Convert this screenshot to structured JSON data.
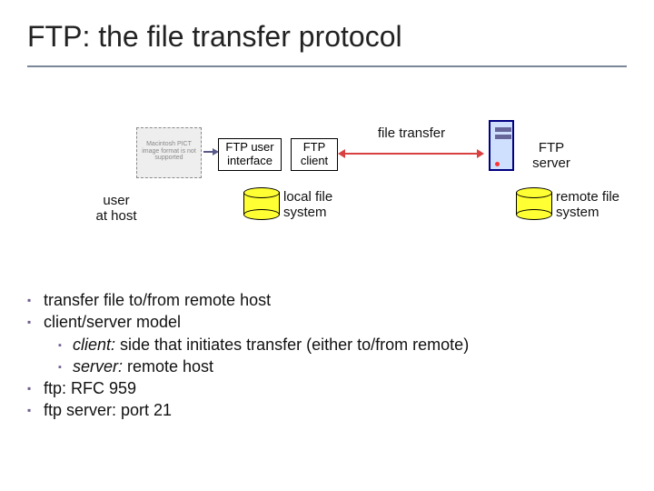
{
  "title": "FTP: the file transfer protocol",
  "diagram": {
    "user_at_host": "user\nat host",
    "ftp_user_interface": "FTP user\ninterface",
    "ftp_client": "FTP\nclient",
    "ftp_server": "FTP\nserver",
    "file_transfer": "file transfer",
    "local_fs": "local file\nsystem",
    "remote_fs": "remote file\nsystem",
    "placeholder_text": "Macintosh PICT\nimage format\nis not supported"
  },
  "bullets": {
    "b1": "transfer file to/from remote host",
    "b2": "client/server model",
    "b2a_term": "client:",
    "b2a_rest": " side that initiates transfer (either to/from remote)",
    "b2b_term": "server:",
    "b2b_rest": " remote host",
    "b3": "ftp: RFC 959",
    "b4": "ftp server: port 21"
  }
}
